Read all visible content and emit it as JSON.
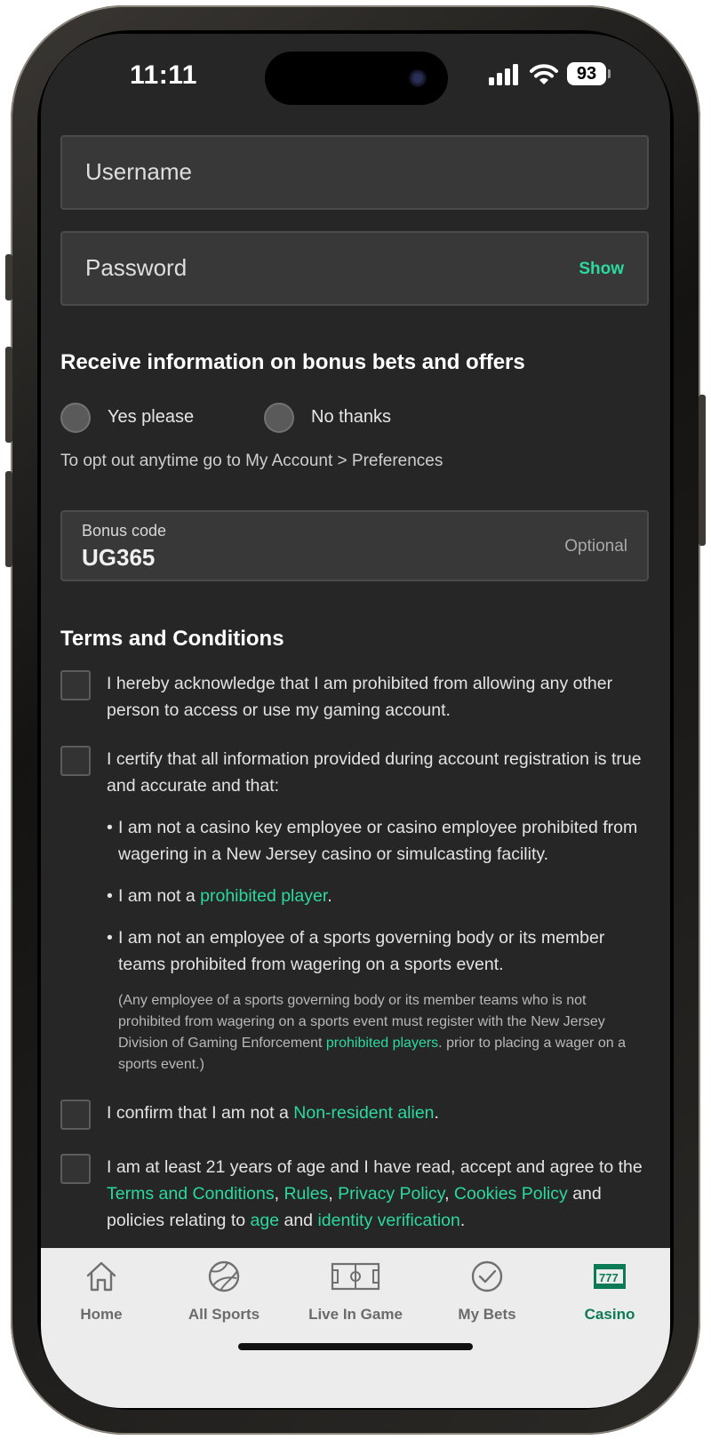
{
  "status_bar": {
    "time": "11:11",
    "battery": "93"
  },
  "login": {
    "username_placeholder": "Username",
    "password_placeholder": "Password",
    "show_label": "Show"
  },
  "offers": {
    "heading": "Receive information on bonus bets and offers",
    "yes_label": "Yes please",
    "no_label": "No thanks",
    "opt_out_note": "To opt out anytime go to My Account > Preferences"
  },
  "bonus": {
    "label": "Bonus code",
    "value": "UG365",
    "optional": "Optional"
  },
  "terms": {
    "heading": "Terms and Conditions",
    "item1": "I hereby acknowledge that I am prohibited from allowing any other person to access or use my gaming account.",
    "item2": "I certify that all information provided during account registration is true and accurate and that:",
    "bullet1": "I am not a casino key employee or casino employee prohibited from wagering in a New Jersey casino or simulcasting facility.",
    "bullet2_pre": "I am not a ",
    "bullet2_link": "prohibited player",
    "bullet2_post": ".",
    "bullet3": "I am not an employee of a sports governing body or its member teams prohibited from wagering on a sports event.",
    "note_pre": "(Any employee of a sports governing body or its member teams who is not prohibited from wagering on a sports event must register with the New Jersey Division of Gaming Enforcement ",
    "note_link": "prohibited players",
    "note_post": ". prior to placing a wager on a sports event.)",
    "item3_pre": "I confirm that I am not a ",
    "item3_link": "Non-resident alien",
    "item3_post": ".",
    "item4_pre": "I am at least 21 years of age and I have read, accept and agree to the ",
    "link_terms": "Terms and Conditions",
    "comma1": ", ",
    "link_rules": "Rules",
    "comma2": ", ",
    "link_privacy": "Privacy Policy",
    "comma3": ", ",
    "link_cookies": "Cookies Policy",
    "item4_mid": " and policies relating to ",
    "link_age": "age",
    "and_word": " and ",
    "link_identity": "identity verification",
    "item4_post": "."
  },
  "tabbar": {
    "tabs": [
      {
        "label": "Home",
        "icon": "home-icon"
      },
      {
        "label": "All Sports",
        "icon": "ball-icon"
      },
      {
        "label": "Live In Game",
        "icon": "pitch-icon"
      },
      {
        "label": "My Bets",
        "icon": "check-circle-icon"
      },
      {
        "label": "Casino",
        "icon": "slot-machine-icon"
      }
    ],
    "active_color": "#0b7a55",
    "link_color": "#2bd99e"
  }
}
